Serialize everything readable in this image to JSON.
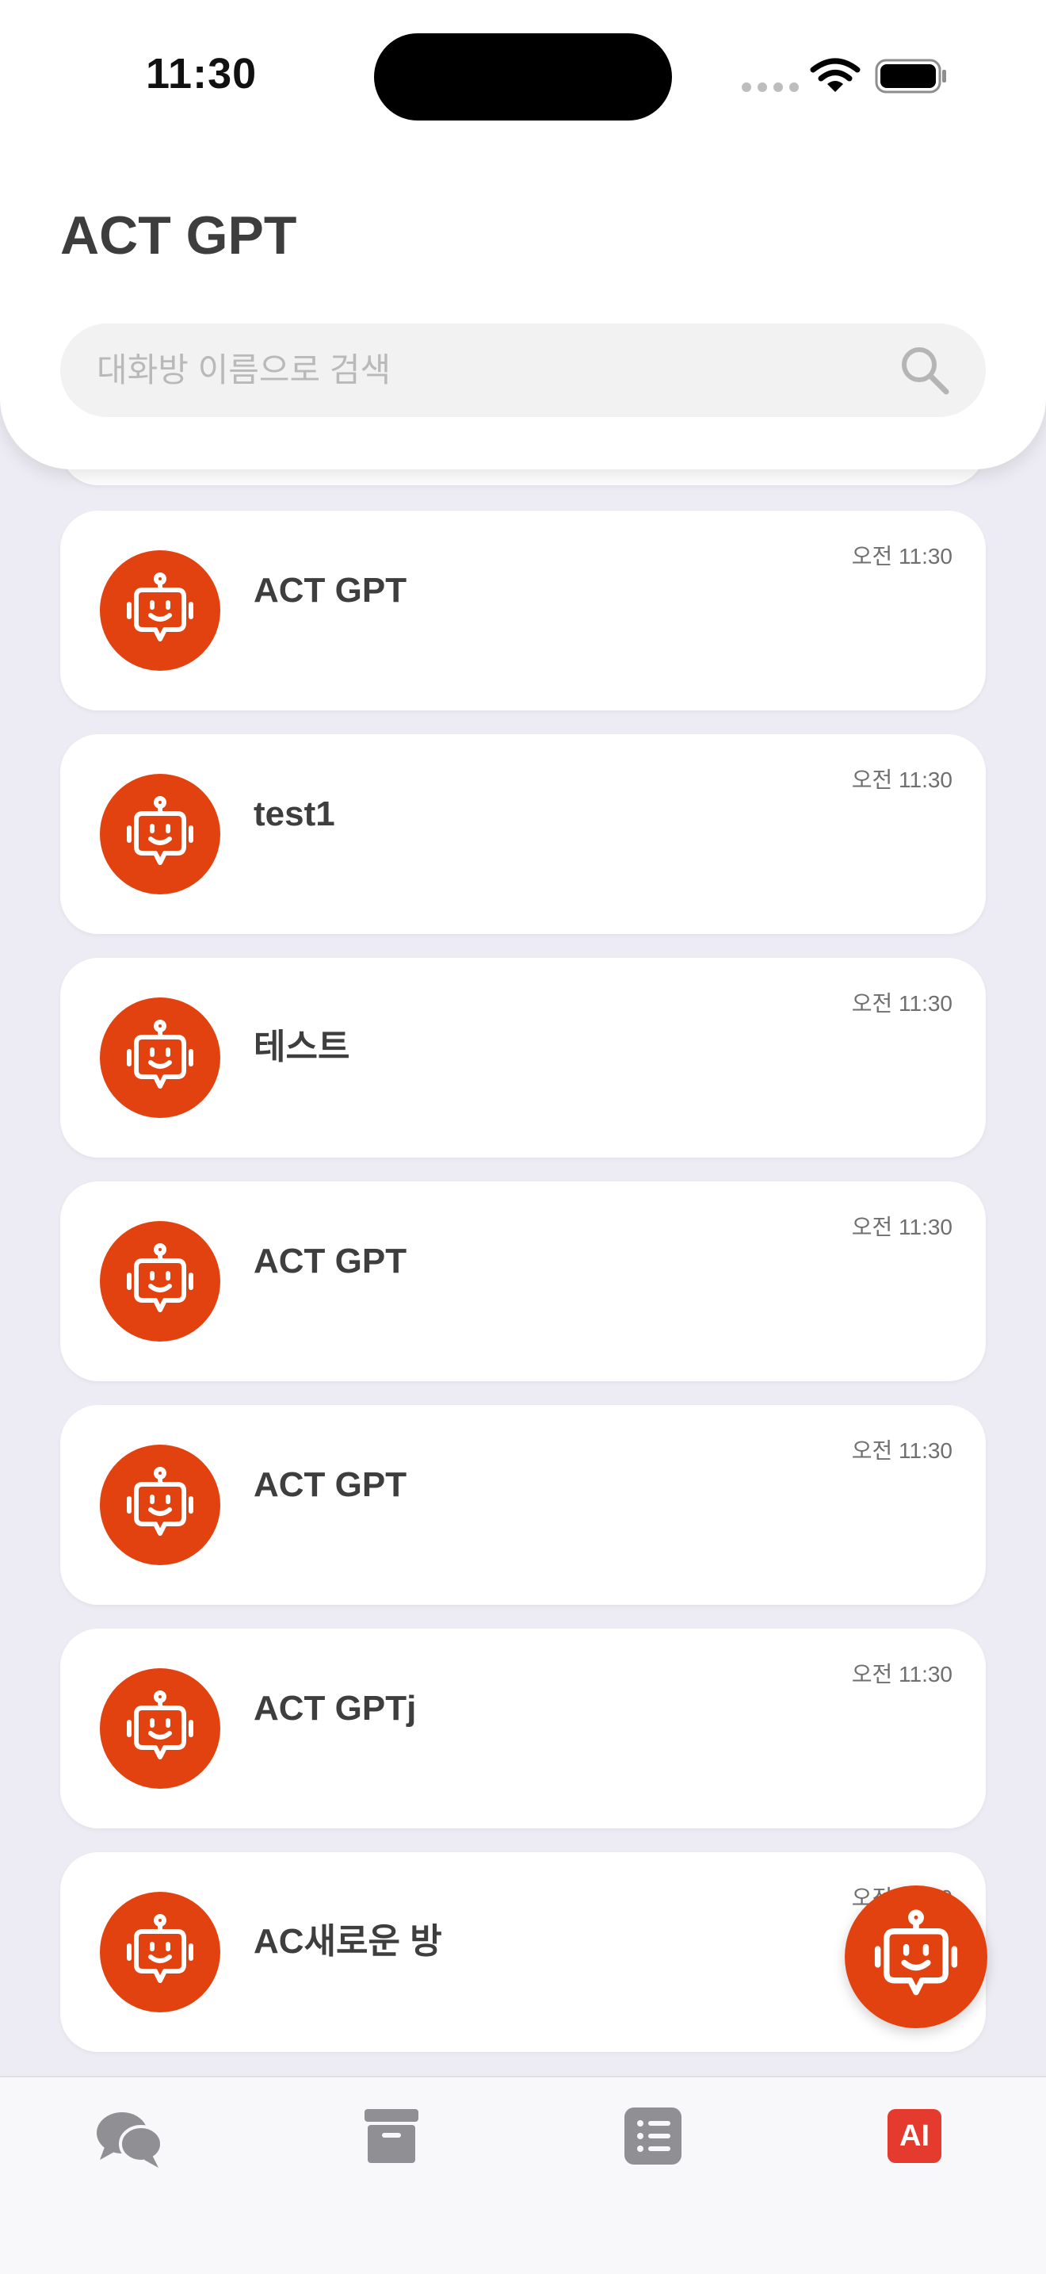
{
  "status_bar": {
    "time": "11:30"
  },
  "header": {
    "title": "ACT GPT"
  },
  "search": {
    "placeholder": "대화방 이름으로 검색"
  },
  "rooms": [
    {
      "name": "ACT GPT",
      "time": "오전 11:30"
    },
    {
      "name": "test1",
      "time": "오전 11:30"
    },
    {
      "name": "테스트",
      "time": "오전 11:30"
    },
    {
      "name": "ACT GPT",
      "time": "오전 11:30"
    },
    {
      "name": "ACT GPT",
      "time": "오전 11:30"
    },
    {
      "name": "ACT GPTj",
      "time": "오전 11:30"
    },
    {
      "name": "AC새로운 방",
      "time": "오전 11:30"
    }
  ],
  "tabbar": {
    "ai_label": "AI"
  },
  "colors": {
    "accent": "#e2420f",
    "ai_badge": "#e43b2e",
    "background": "#edecf4"
  }
}
